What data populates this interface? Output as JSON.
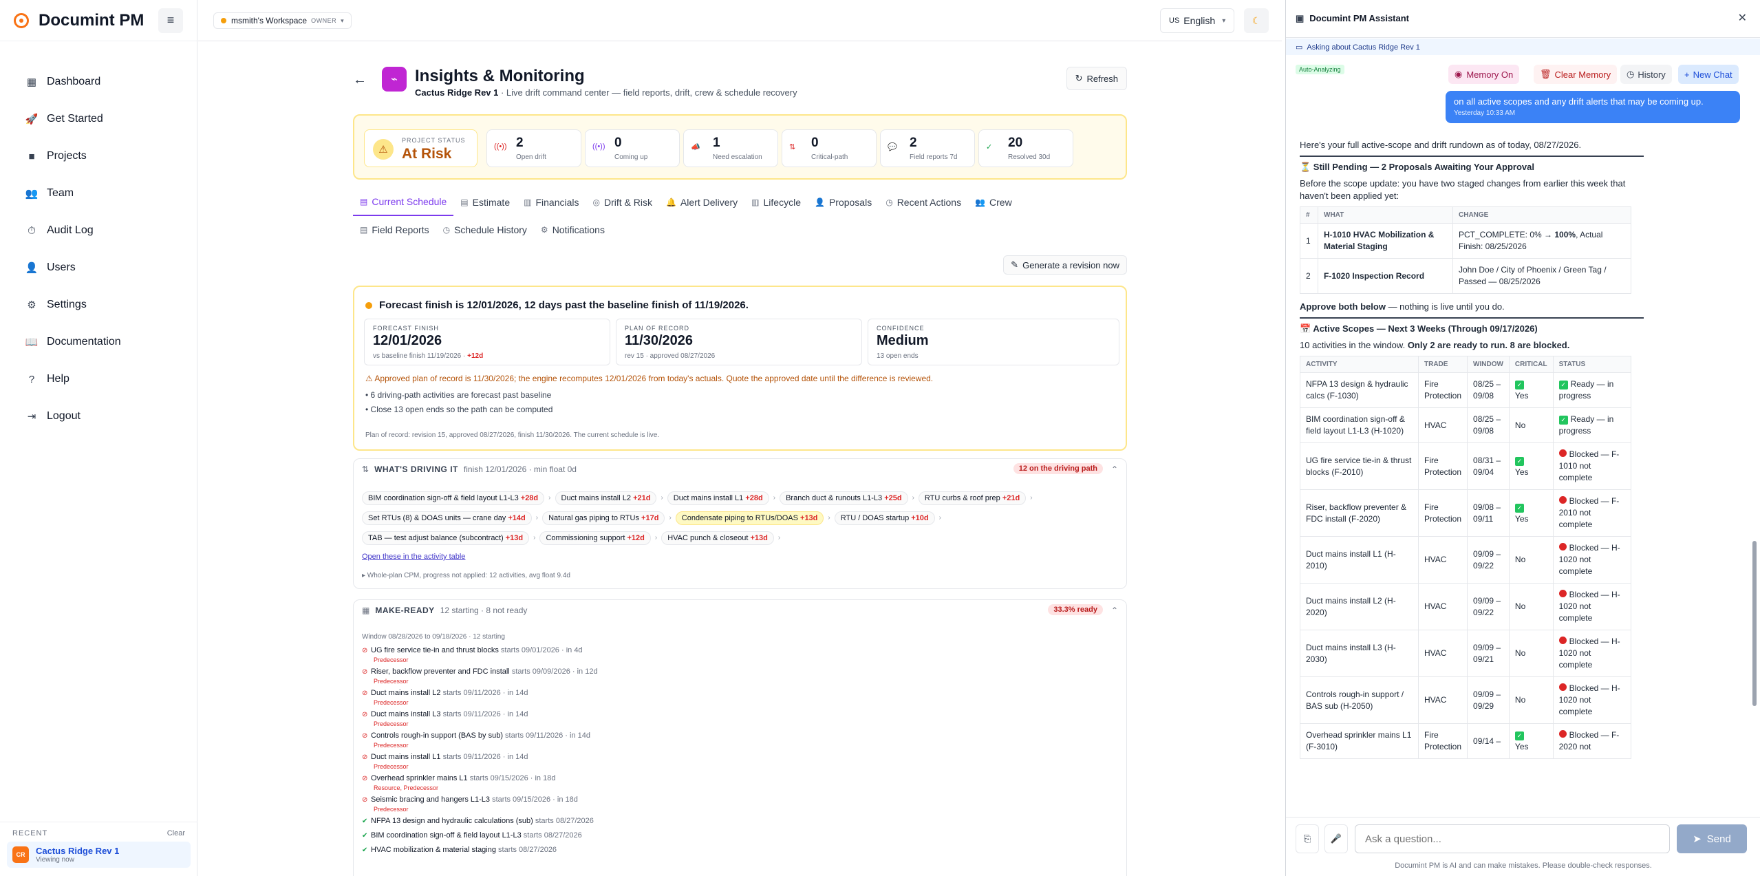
{
  "app": {
    "name": "Documint PM"
  },
  "sidebar": {
    "items": [
      {
        "label": "Dashboard",
        "icon": "▦"
      },
      {
        "label": "Get Started",
        "icon": "🚀"
      },
      {
        "label": "Projects",
        "icon": "■"
      },
      {
        "label": "Team",
        "icon": "👥"
      },
      {
        "label": "Audit Log",
        "icon": "⏱"
      },
      {
        "label": "Users",
        "icon": "👤"
      },
      {
        "label": "Settings",
        "icon": "⚙"
      },
      {
        "label": "Documentation",
        "icon": "📖"
      },
      {
        "label": "Help",
        "icon": "?"
      },
      {
        "label": "Logout",
        "icon": "⇥"
      }
    ],
    "recent": {
      "heading": "RECENT",
      "clear": "Clear",
      "badge": "CR",
      "name": "Cactus Ridge Rev 1",
      "sub": "Viewing now"
    }
  },
  "topbar": {
    "workspace": "msmith's Workspace",
    "role": "OWNER",
    "language_flag": "US",
    "language": "English"
  },
  "page": {
    "title": "Insights & Monitoring",
    "project": "Cactus Ridge Rev 1",
    "subtitle": " · Live drift command center — field reports, drift, crew & schedule recovery",
    "refresh": "Refresh"
  },
  "status": {
    "label": "PROJECT STATUS",
    "value": "At Risk",
    "kpis": [
      {
        "n": "2",
        "t": "Open drift",
        "icon": "((•))",
        "color": "#dc2626"
      },
      {
        "n": "0",
        "t": "Coming up",
        "icon": "((•))",
        "color": "#7c3aed"
      },
      {
        "n": "1",
        "t": "Need escalation",
        "icon": "📣",
        "color": "#f97316"
      },
      {
        "n": "0",
        "t": "Critical-path",
        "icon": "⇅",
        "color": "#dc2626"
      },
      {
        "n": "2",
        "t": "Field reports 7d",
        "icon": "💬",
        "color": "#2563eb"
      },
      {
        "n": "20",
        "t": "Resolved 30d",
        "icon": "✓",
        "color": "#16a34a"
      }
    ]
  },
  "tabs": {
    "row1": [
      {
        "label": "Current Schedule",
        "icon": "▤"
      },
      {
        "label": "Estimate",
        "icon": "▤"
      },
      {
        "label": "Financials",
        "icon": "▥"
      },
      {
        "label": "Drift & Risk",
        "icon": "◎"
      },
      {
        "label": "Alert Delivery",
        "icon": "🔔"
      },
      {
        "label": "Lifecycle",
        "icon": "▥"
      },
      {
        "label": "Proposals",
        "icon": "👤"
      },
      {
        "label": "Recent Actions",
        "icon": "◷"
      },
      {
        "label": "Crew",
        "icon": "👥"
      }
    ],
    "row2": [
      {
        "label": "Field Reports",
        "icon": "▤"
      },
      {
        "label": "Schedule History",
        "icon": "◷"
      },
      {
        "label": "Notifications",
        "icon": "⚙"
      }
    ],
    "generate": "Generate a revision now"
  },
  "forecast": {
    "headline": "Forecast finish is 12/01/2026, 12 days past the baseline finish of 11/19/2026.",
    "boxes": [
      {
        "lbl": "FORECAST FINISH",
        "v": "12/01/2026",
        "s": "vs baseline finish 11/19/2026 · ",
        "d": "+12d"
      },
      {
        "lbl": "PLAN OF RECORD",
        "v": "11/30/2026",
        "s": "rev 15 · approved 08/27/2026",
        "d": ""
      },
      {
        "lbl": "CONFIDENCE",
        "v": "Medium",
        "s": "13 open ends",
        "d": ""
      }
    ],
    "warning": "⚠  Approved plan of record is 11/30/2026; the engine recomputes 12/01/2026 from today's actuals. Quote the approved date until the difference is reviewed.",
    "bullets": [
      "6 driving-path activities are forecast past baseline",
      "Close 13 open ends so the path can be computed"
    ],
    "footer": "Plan of record: revision 15, approved 08/27/2026, finish 11/30/2026. The current schedule is live."
  },
  "driving": {
    "title": "WHAT'S DRIVING IT",
    "sub": "finish 12/01/2026 · min float 0d",
    "badge": "12 on the driving path",
    "rows": [
      [
        {
          "t": "BIM coordination sign-off & field layout L1-L3",
          "d": "+28d"
        },
        {
          "t": "Duct mains install L2",
          "d": "+21d"
        },
        {
          "t": "Duct mains install L1",
          "d": "+28d"
        },
        {
          "t": "Branch duct & runouts L1-L3",
          "d": "+25d"
        },
        {
          "t": "RTU curbs & roof prep",
          "d": "+21d"
        }
      ],
      [
        {
          "t": "Set RTUs (8) & DOAS units — crane day",
          "d": "+14d"
        },
        {
          "t": "Natural gas piping to RTUs",
          "d": "+17d"
        },
        {
          "t": "Condensate piping to RTUs/DOAS",
          "d": "+13d",
          "hl": true
        },
        {
          "t": "RTU / DOAS startup",
          "d": "+10d"
        }
      ],
      [
        {
          "t": "TAB — test adjust balance (subcontract)",
          "d": "+13d"
        },
        {
          "t": "Commissioning support",
          "d": "+12d"
        },
        {
          "t": "HVAC punch & closeout",
          "d": "+13d"
        }
      ]
    ],
    "link": "Open these in the activity table",
    "cpm": "▸ Whole-plan CPM, progress not applied: 12 activities, avg float 9.4d"
  },
  "makeready": {
    "title": "MAKE-READY",
    "sub": "12 starting · 8 not ready",
    "badge": "33.3% ready",
    "window": "Window 08/28/2026 to 09/18/2026 · 12 starting",
    "items": [
      {
        "name": "UG fire service tie-in and thrust blocks",
        "meta": "starts 09/01/2026 · in 4d",
        "reason": "Predecessor",
        "ok": false
      },
      {
        "name": "Riser, backflow preventer and FDC install",
        "meta": "starts 09/09/2026 · in 12d",
        "reason": "Predecessor",
        "ok": false
      },
      {
        "name": "Duct mains install L2",
        "meta": "starts 09/11/2026 · in 14d",
        "reason": "Predecessor",
        "ok": false
      },
      {
        "name": "Duct mains install L3",
        "meta": "starts 09/11/2026 · in 14d",
        "reason": "Predecessor",
        "ok": false
      },
      {
        "name": "Controls rough-in support (BAS by sub)",
        "meta": "starts 09/11/2026 · in 14d",
        "reason": "Predecessor",
        "ok": false
      },
      {
        "name": "Duct mains install L1",
        "meta": "starts 09/11/2026 · in 14d",
        "reason": "Predecessor",
        "ok": false
      },
      {
        "name": "Overhead sprinkler mains L1",
        "meta": "starts 09/15/2026 · in 18d",
        "reason": "Resource, Predecessor",
        "ok": false
      },
      {
        "name": "Seismic bracing and hangers L1-L3",
        "meta": "starts 09/15/2026 · in 18d",
        "reason": "Predecessor",
        "ok": false
      },
      {
        "name": "NFPA 13 design and hydraulic calculations (sub)",
        "meta": "starts 08/27/2026",
        "reason": "",
        "ok": true
      },
      {
        "name": "BIM coordination sign-off & field layout L1-L3",
        "meta": "starts 08/27/2026",
        "reason": "",
        "ok": true
      },
      {
        "name": "HVAC mobilization & material staging",
        "meta": "starts 08/27/2026",
        "reason": "",
        "ok": true
      }
    ]
  },
  "assistant": {
    "title": "Documint PM Assistant",
    "context": "Asking about Cactus Ridge Rev 1",
    "auto": "Auto-Analyzing",
    "buttons": {
      "memory": "Memory On",
      "clear": "Clear Memory",
      "history": "History",
      "new": "New Chat"
    },
    "user_msg": "on all active scopes and any drift alerts that may be coming up.",
    "user_time": "Yesterday 10:33 AM",
    "intro": "Here's your full active-scope and drift rundown as of today, 08/27/2026.",
    "pending_title": "⏳ Still Pending — 2 Proposals Awaiting Your Approval",
    "pending_text": "Before the scope update: you have two staged changes from earlier this week that haven't been applied yet:",
    "pending_headers": {
      "num": "#",
      "what": "WHAT",
      "change": "CHANGE"
    },
    "pending_rows": [
      {
        "num": "1",
        "what": "H-1010 HVAC Mobilization & Material Staging",
        "change_a": "PCT_COMPLETE: 0% → ",
        "change_b": "100%",
        "change_c": ", Actual Finish: 08/25/2026"
      },
      {
        "num": "2",
        "what": "F-1020 Inspection Record",
        "change_a": "John Doe / City of Phoenix / Green Tag / Passed — 08/25/2026",
        "change_b": "",
        "change_c": ""
      }
    ],
    "approve_b": "Approve both below",
    "approve_rest": " — nothing is live until you do.",
    "scopes_title": "📅 Active Scopes — Next 3 Weeks (Through 09/17/2026)",
    "scopes_pre": "10 activities in the window. ",
    "scopes_b": "Only 2 are ready to run. 8 are blocked.",
    "scope_headers": {
      "activity": "ACTIVITY",
      "trade": "TRADE",
      "window": "WINDOW",
      "critical": "CRITICAL",
      "status": "STATUS"
    },
    "scope_rows": [
      {
        "activity": "NFPA 13 design & hydraulic calcs (F-1030)",
        "trade": "Fire Protection",
        "window": "08/25 – 09/08",
        "critical": "Yes",
        "crit_chk": true,
        "status": "Ready — in progress",
        "ok": true
      },
      {
        "activity": "BIM coordination sign-off & field layout L1-L3 (H-1020)",
        "trade": "HVAC",
        "window": "08/25 – 09/08",
        "critical": "No",
        "crit_chk": false,
        "status": "Ready — in progress",
        "ok": true
      },
      {
        "activity": "UG fire service tie-in & thrust blocks (F-2010)",
        "trade": "Fire Protection",
        "window": "08/31 – 09/04",
        "critical": "Yes",
        "crit_chk": true,
        "status": "Blocked — F-1010 not complete",
        "ok": false
      },
      {
        "activity": "Riser, backflow preventer & FDC install (F-2020)",
        "trade": "Fire Protection",
        "window": "09/08 – 09/11",
        "critical": "Yes",
        "crit_chk": true,
        "status": "Blocked — F-2010 not complete",
        "ok": false
      },
      {
        "activity": "Duct mains install L1 (H-2010)",
        "trade": "HVAC",
        "window": "09/09 – 09/22",
        "critical": "No",
        "crit_chk": false,
        "status": "Blocked — H-1020 not complete",
        "ok": false
      },
      {
        "activity": "Duct mains install L2 (H-2020)",
        "trade": "HVAC",
        "window": "09/09 – 09/22",
        "critical": "No",
        "crit_chk": false,
        "status": "Blocked — H-1020 not complete",
        "ok": false
      },
      {
        "activity": "Duct mains install L3 (H-2030)",
        "trade": "HVAC",
        "window": "09/09 – 09/21",
        "critical": "No",
        "crit_chk": false,
        "status": "Blocked — H-1020 not complete",
        "ok": false
      },
      {
        "activity": "Controls rough-in support / BAS sub (H-2050)",
        "trade": "HVAC",
        "window": "09/09 – 09/29",
        "critical": "No",
        "crit_chk": false,
        "status": "Blocked — H-1020 not complete",
        "ok": false
      },
      {
        "activity": "Overhead sprinkler mains L1 (F-3010)",
        "trade": "Fire Protection",
        "window": "09/14 –",
        "critical": "Yes",
        "crit_chk": true,
        "status": "Blocked — F-2020 not",
        "ok": false
      }
    ],
    "composer": {
      "placeholder": "Ask a question...",
      "send": "Send",
      "footer": "Documint PM is AI and can make mistakes. Please double-check responses."
    }
  }
}
